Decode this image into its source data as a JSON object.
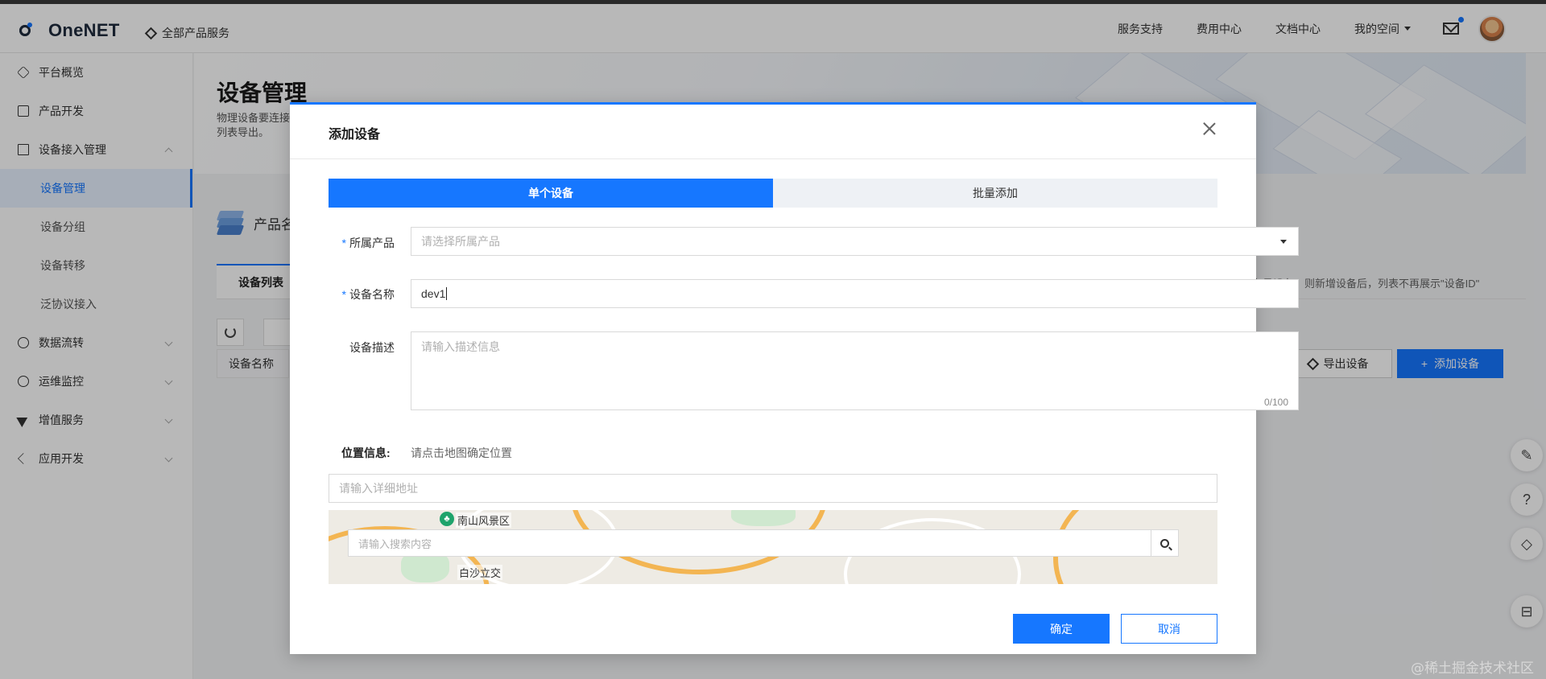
{
  "header": {
    "logo": "OneNET",
    "all_products": "全部产品服务",
    "nav": [
      "服务支持",
      "费用中心",
      "文档中心",
      "我的空间"
    ]
  },
  "sidebar": {
    "items": [
      {
        "label": "平台概览",
        "icon": "hexagon-icon"
      },
      {
        "label": "产品开发",
        "icon": "cube-icon"
      },
      {
        "label": "设备接入管理",
        "icon": "device-link-icon",
        "expanded": true,
        "children": [
          "设备管理",
          "设备分组",
          "设备转移",
          "泛协议接入"
        ],
        "active_child": "设备管理"
      },
      {
        "label": "数据流转",
        "icon": "pie-icon"
      },
      {
        "label": "运维监控",
        "icon": "clock-icon"
      },
      {
        "label": "增值服务",
        "icon": "send-icon"
      },
      {
        "label": "应用开发",
        "icon": "code-icon"
      }
    ]
  },
  "page": {
    "title": "设备管理",
    "desc": "物理设备要连接和列表导出。",
    "product_label": "产品名",
    "tab": "设备列表",
    "hint": "存量设备，则新增设备后，列表不再展示\"设备ID\"",
    "filter_placeholder": "设",
    "col_header": "设备名称",
    "export_btn": "导出设备",
    "add_btn": "添加设备"
  },
  "modal": {
    "title": "添加设备",
    "tabs": [
      "单个设备",
      "批量添加"
    ],
    "active_tab": 0,
    "product_label": "所属产品",
    "product_placeholder": "请选择所属产品",
    "name_label": "设备名称",
    "name_value": "dev1",
    "desc_label": "设备描述",
    "desc_placeholder": "请输入描述信息",
    "desc_counter": "0/100",
    "location_label": "位置信息:",
    "location_hint": "请点击地图确定位置",
    "address_placeholder": "请输入详细地址",
    "map_search_placeholder": "请输入搜索内容",
    "map_labels": [
      "南山风景区",
      "白沙立交"
    ],
    "ok": "确定",
    "cancel": "取消"
  },
  "colors": {
    "primary": "#1677ff"
  },
  "watermark": "@稀土掘金技术社区"
}
